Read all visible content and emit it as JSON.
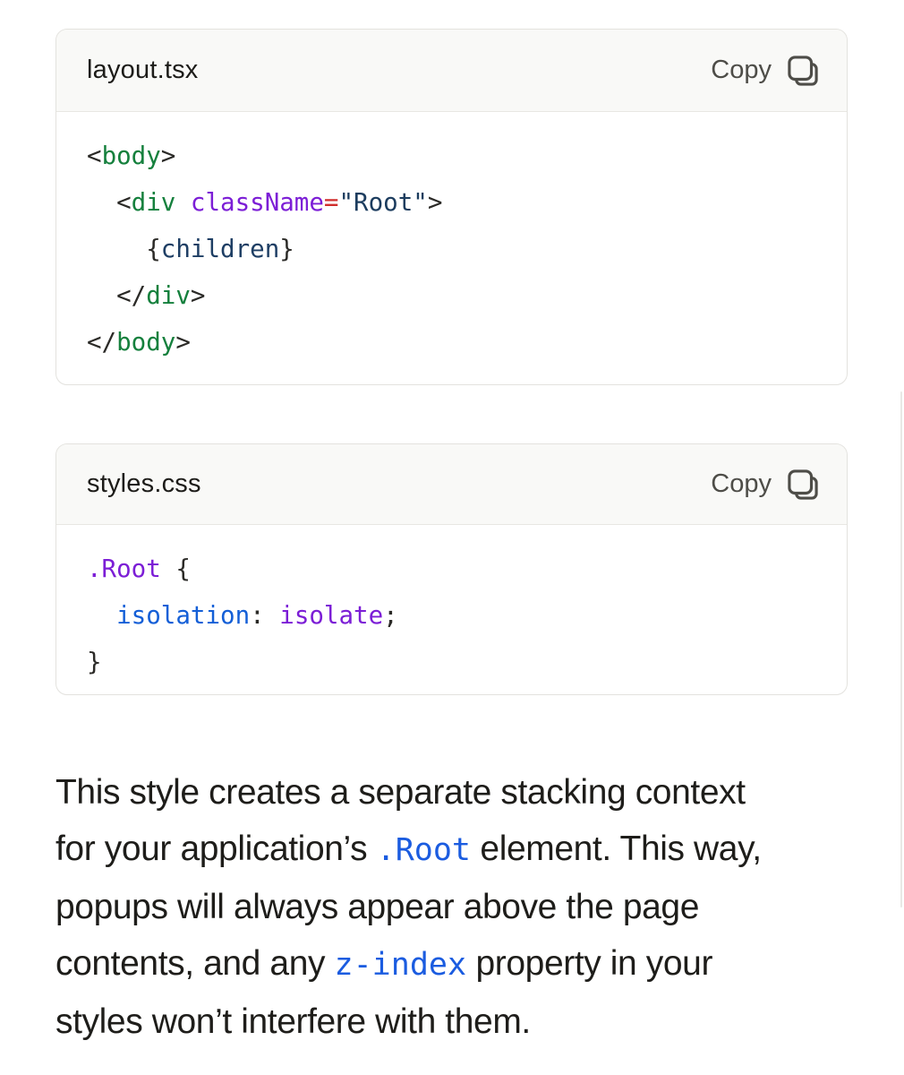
{
  "colors": {
    "card-border": "#e3e2de",
    "header-bg": "#f9f9f7",
    "divider": "#e8e7e3",
    "text-strong": "#1d1c19",
    "text-body": "#1e1d1a",
    "copy-gray": "#4e4d48",
    "code-punct": "#2b2a27",
    "tag-green": "#15803d",
    "attr-purple": "#7c1ed6",
    "equals-red": "#d02d2c",
    "string-navy": "#1c3c5e",
    "var-navy": "#1e3e64",
    "prop-blue": "#145fd7",
    "inline-code-blue": "#1b5ce0",
    "scroll-gray": "#e9e8e5"
  },
  "code_blocks": [
    {
      "filename": "layout.tsx",
      "copy_label": "Copy",
      "lines": [
        [
          {
            "t": "<",
            "c": "pun"
          },
          {
            "t": "body",
            "c": "tag"
          },
          {
            "t": ">",
            "c": "pun"
          }
        ],
        [
          {
            "t": "  <",
            "c": "pun"
          },
          {
            "t": "div",
            "c": "tag"
          },
          {
            "t": " ",
            "c": "pun"
          },
          {
            "t": "className",
            "c": "attr"
          },
          {
            "t": "=",
            "c": "op"
          },
          {
            "t": "\"Root\"",
            "c": "str"
          },
          {
            "t": ">",
            "c": "pun"
          }
        ],
        [
          {
            "t": "    {",
            "c": "pun"
          },
          {
            "t": "children",
            "c": "var"
          },
          {
            "t": "}",
            "c": "pun"
          }
        ],
        [
          {
            "t": "  </",
            "c": "pun"
          },
          {
            "t": "div",
            "c": "tag"
          },
          {
            "t": ">",
            "c": "pun"
          }
        ],
        [
          {
            "t": "</",
            "c": "pun"
          },
          {
            "t": "body",
            "c": "tag"
          },
          {
            "t": ">",
            "c": "pun"
          }
        ]
      ]
    },
    {
      "filename": "styles.css",
      "copy_label": "Copy",
      "lines": [
        [
          {
            "t": ".Root",
            "c": "sel"
          },
          {
            "t": " {",
            "c": "pun"
          }
        ],
        [
          {
            "t": "  ",
            "c": "pun"
          },
          {
            "t": "isolation",
            "c": "prop"
          },
          {
            "t": ":",
            "c": "pun"
          },
          {
            "t": " ",
            "c": "pun"
          },
          {
            "t": "isolate",
            "c": "val"
          },
          {
            "t": ";",
            "c": "pun"
          }
        ],
        [
          {
            "t": "}",
            "c": "pun"
          }
        ]
      ]
    }
  ],
  "paragraph": {
    "lines": [
      [
        {
          "k": "text",
          "t": "This style creates a separate stacking context"
        }
      ],
      [
        {
          "k": "text",
          "t": "for your application’s "
        },
        {
          "k": "code",
          "t": ".Root"
        },
        {
          "k": "text",
          "t": " element. This way,"
        }
      ],
      [
        {
          "k": "text",
          "t": "popups will always appear above the page"
        }
      ],
      [
        {
          "k": "text",
          "t": "contents, and any "
        },
        {
          "k": "code",
          "t": "z-index"
        },
        {
          "k": "text",
          "t": " property in your"
        }
      ],
      [
        {
          "k": "text",
          "t": "styles won’t interfere with them."
        }
      ]
    ]
  }
}
